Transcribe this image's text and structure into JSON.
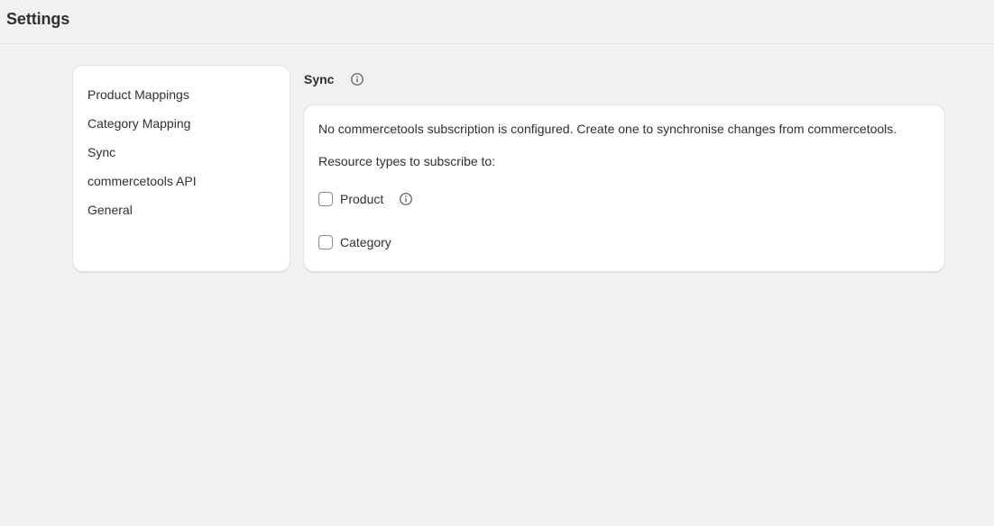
{
  "header": {
    "title": "Settings"
  },
  "sidebar": {
    "items": [
      {
        "label": "Product Mappings"
      },
      {
        "label": "Category Mapping"
      },
      {
        "label": "Sync"
      },
      {
        "label": "commercetools API"
      },
      {
        "label": "General"
      }
    ]
  },
  "section": {
    "title": "Sync",
    "info_icon": "info-circle-icon"
  },
  "card": {
    "message": "No commercetools subscription is configured. Create one to synchronise changes from commercetools.",
    "subtitle": "Resource types to subscribe to:",
    "resource_types": [
      {
        "label": "Product",
        "checked": false,
        "has_info_icon": true
      },
      {
        "label": "Category",
        "checked": false,
        "has_info_icon": false
      }
    ]
  },
  "colors": {
    "background": "#f1f1f1",
    "card": "#ffffff",
    "text": "#303030",
    "icon": "#616161",
    "checkbox_border": "#8a8a8a"
  }
}
